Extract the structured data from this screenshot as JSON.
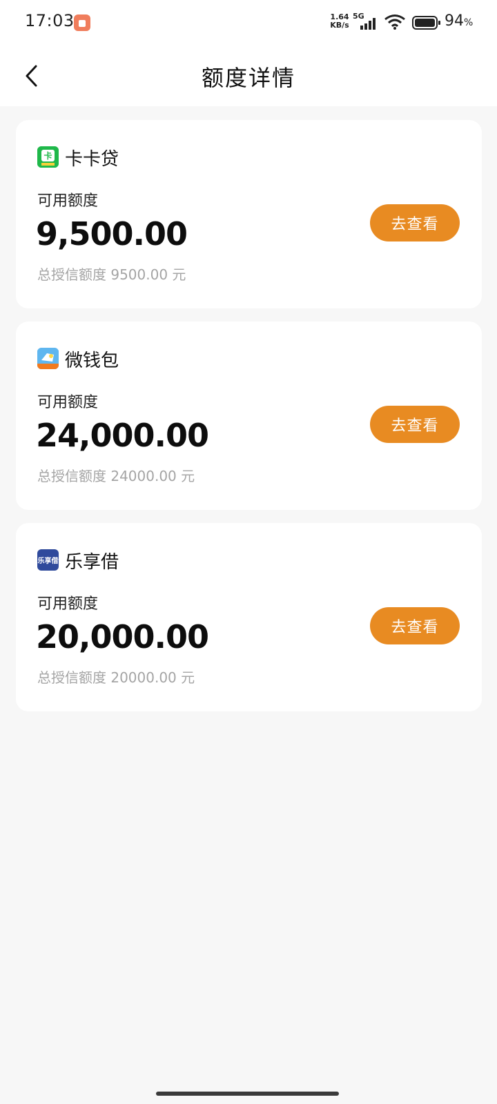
{
  "status_bar": {
    "time": "17:03",
    "net_speed_value": "1.64",
    "net_speed_unit": "KB/s",
    "network_type": "5G",
    "battery_level": "94",
    "battery_unit": "%"
  },
  "header": {
    "title": "额度详情"
  },
  "cards": [
    {
      "name": "卡卡贷",
      "available_label": "可用额度",
      "available_amount": "9,500.00",
      "total_text": "总授信额度 9500.00 元",
      "button_label": "去查看"
    },
    {
      "name": "微钱包",
      "available_label": "可用额度",
      "available_amount": "24,000.00",
      "total_text": "总授信额度 24000.00 元",
      "button_label": "去查看"
    },
    {
      "name": "乐享借",
      "available_label": "可用额度",
      "available_amount": "20,000.00",
      "total_text": "总授信额度 20000.00 元",
      "button_label": "去查看"
    }
  ],
  "logos": {
    "kakadai_logo_text": "卡",
    "lexiangjie_logo_text": "乐享借"
  },
  "colors": {
    "accent": "#e88b22",
    "background": "#f7f7f7",
    "card": "#ffffff",
    "muted_text": "#a4a4a4"
  }
}
